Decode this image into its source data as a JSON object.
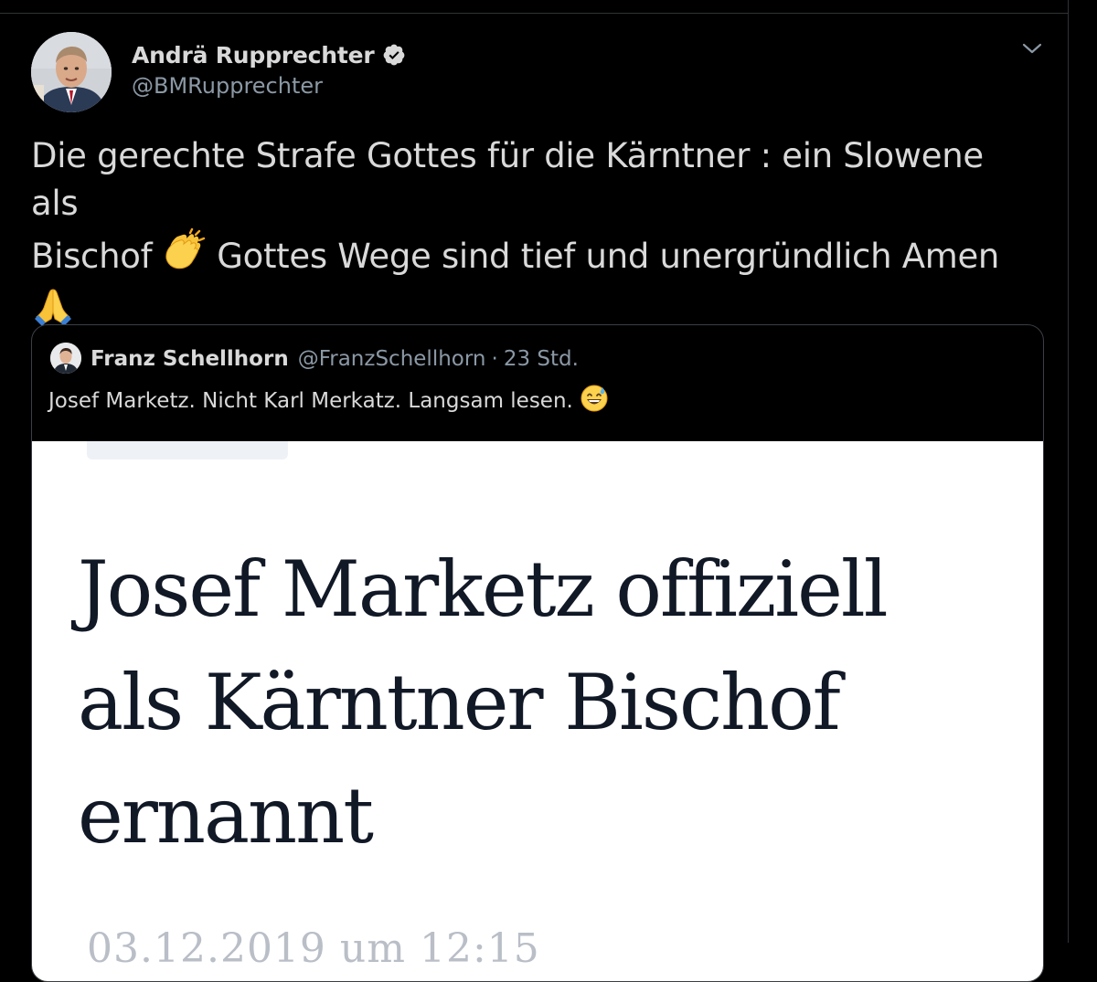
{
  "tweet": {
    "author_name": "Andrä Rupprechter",
    "author_handle": "@BMRupprechter",
    "verified": true,
    "text_line1": "Die gerechte Strafe Gottes für die Kärntner : ein Slowene als",
    "text_line2_start": "Bischof",
    "text_line2_end": "Gottes Wege sind tief und unergründlich Amen",
    "emojis": [
      "clapping-hands",
      "folded-hands"
    ]
  },
  "quote": {
    "author_name": "Franz Schellhorn",
    "author_handle": "@FranzSchellhorn",
    "separator": "·",
    "time": "23 Std.",
    "text": "Josef Marketz. Nicht Karl Merkatz. Langsam lesen.",
    "emoji": "grinning-face-with-sweat"
  },
  "news_image": {
    "headline_line1": "Josef Marketz offiziell",
    "headline_line2": "als Kärntner Bischof",
    "headline_line3": "ernannt",
    "date_partial": "03.12.2019 um 12:15"
  },
  "colors": {
    "background": "#000000",
    "text_primary": "#d9d9d9",
    "text_secondary": "#8b98a5",
    "verified_badge": "#d9d9d9",
    "border": "#3a3f44",
    "headline": "#111826"
  }
}
